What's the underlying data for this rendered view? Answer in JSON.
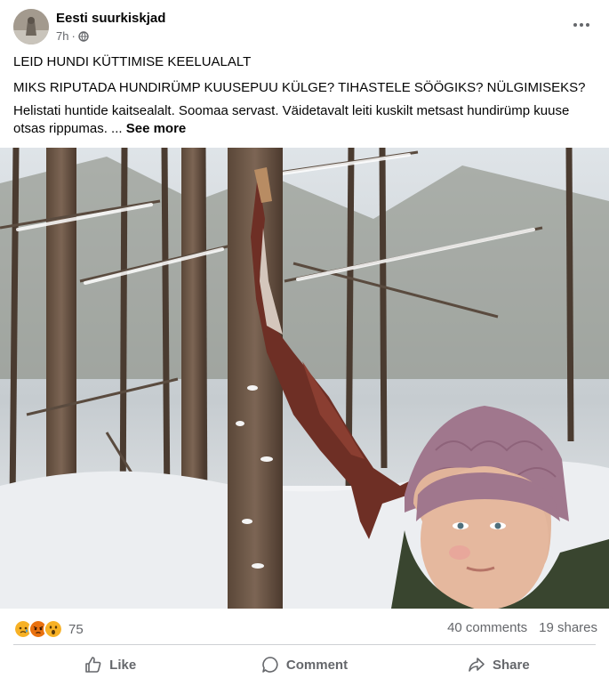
{
  "post": {
    "author": "Eesti suurkiskjad",
    "time": "7h",
    "separator": "·",
    "audience_icon": "globe-icon",
    "headline": "LEID HUNDI KÜTTIMISE KEELUALALT",
    "question": "MIKS RIPUTADA HUNDIRÜMP KUUSEPUU KÜLGE? TIHASTELE SÖÖGIKS? NÜLGIMISEKS?",
    "body": "Helistati huntide kaitsealalt. Soomaa servast. Väidetavalt leiti kuskilt metsast hundirümp kuuse otsas rippumas. ...",
    "see_more": "See more"
  },
  "stats": {
    "reaction_icons": [
      "sad-icon",
      "angry-icon",
      "wow-icon"
    ],
    "reaction_count": "75",
    "comments": "40 comments",
    "shares": "19 shares"
  },
  "actions": {
    "like": "Like",
    "comment": "Comment",
    "share": "Share"
  },
  "colors": {
    "text_primary": "#050505",
    "text_secondary": "#65676b",
    "divider": "#ced0d4",
    "reaction_yellow": "#f7b125",
    "reaction_red": "#e9710f"
  }
}
